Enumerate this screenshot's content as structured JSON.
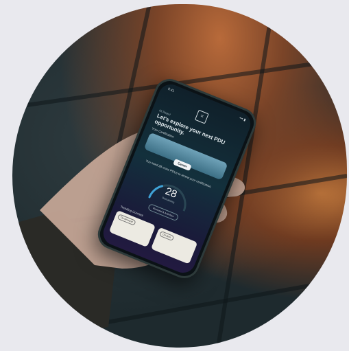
{
  "phone_screen": {
    "status": {
      "time": "9:41",
      "signal": "▪▪▪ ▮"
    },
    "logo_glyph": "⌗",
    "greeting": "Hi Peter!",
    "headline": "Let's explore your next PDU opportunity.",
    "section_title": "Your Certification",
    "card_button": "Career",
    "note": "You need 28 more PDUs to renew your certification.",
    "gauge": {
      "value": "28",
      "label": "Remaining",
      "button": "Renewal & Activities",
      "fraction": 0.3
    },
    "trending_title": "Trending Courses",
    "courses": [
      {
        "tag": "On-demand"
      },
      {
        "tag": "On-dem"
      }
    ]
  },
  "colors": {
    "accent": "#3fa2d6",
    "background": "#e9e9ee"
  }
}
